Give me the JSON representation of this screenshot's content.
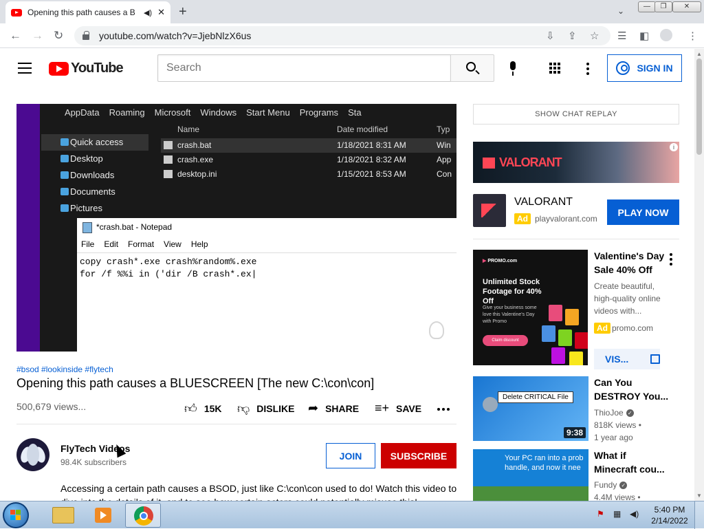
{
  "browser": {
    "tab_title": "Opening this path causes a B",
    "new_tab": "+",
    "url": "youtube.com/watch?v=JjebNlzX6us",
    "window_buttons": [
      "—",
      "❐",
      "✕"
    ]
  },
  "youtube": {
    "logo_text": "YouTube",
    "search_placeholder": "Search",
    "sign_in": "SIGN IN"
  },
  "video": {
    "explorer_path": [
      "AppData",
      "Roaming",
      "Microsoft",
      "Windows",
      "Start Menu",
      "Programs",
      "Sta"
    ],
    "nav_items": [
      "Quick access",
      "Desktop",
      "Downloads",
      "Documents",
      "Pictures"
    ],
    "columns": [
      "Name",
      "Date modified",
      "Typ"
    ],
    "files": [
      {
        "name": "crash.bat",
        "date": "1/18/2021 8:31 AM",
        "type": "Win"
      },
      {
        "name": "crash.exe",
        "date": "1/18/2021 8:32 AM",
        "type": "App"
      },
      {
        "name": "desktop.ini",
        "date": "1/15/2021 8:53 AM",
        "type": "Con"
      }
    ],
    "notepad_title": "*crash.bat - Notepad",
    "notepad_menu": [
      "File",
      "Edit",
      "Format",
      "View",
      "Help"
    ],
    "notepad_lines": [
      "copy crash*.exe crash%random%.exe",
      "for /f %%i in ('dir /B crash*.ex|"
    ]
  },
  "info": {
    "tags": "#bsod #lookinside #flytech",
    "title": "Opening this path causes a BLUESCREEN [The new C:\\con\\con]",
    "views": "500,679 views...",
    "likes": "15K",
    "dislike": "DISLIKE",
    "share": "SHARE",
    "save": "SAVE"
  },
  "channel": {
    "name": "FlyTech Videos",
    "subscribers": "98.4K subscribers",
    "join": "JOIN",
    "subscribe": "SUBSCRIBE",
    "description": "Accessing a certain path causes a BSOD, just like C:\\con\\con used to do! Watch this video to dive into the details of it, and to see how certain actors could potentially misuse this!"
  },
  "sidebar": {
    "chat_replay": "SHOW CHAT REPLAY",
    "ad_banner_brand": "VALORANT",
    "ad_name": "VALORANT",
    "ad_badge": "Ad",
    "ad_domain": "playvalorant.com",
    "play_now": "PLAY NOW",
    "promo_ad": {
      "brand": "PROMO",
      "brand_suffix": ".com",
      "headline": "Unlimited Stock Footage for 40% Off",
      "subtext": "Give your business some love this Valentine's Day with Promo",
      "cta": "Claim discount",
      "title": "Valentine's Day Sale 40% Off",
      "description": "Create beautiful, high-quality online videos with...",
      "badge": "Ad",
      "domain": "promo.com",
      "visit": "VIS..."
    },
    "videos": [
      {
        "title": "Can You DESTROY You...",
        "channel": "ThioJoe",
        "views": "818K views •",
        "age": "1 year ago",
        "duration": "9:38",
        "thumb_text": "Delete CRITICAL File"
      },
      {
        "title": "What if Minecraft cou...",
        "channel": "Fundy",
        "views": "4.4M views •",
        "thumb_text": "Your PC ran into a prob handle, and now it nee"
      }
    ]
  },
  "taskbar": {
    "time": "5:40 PM",
    "date": "2/14/2022"
  }
}
